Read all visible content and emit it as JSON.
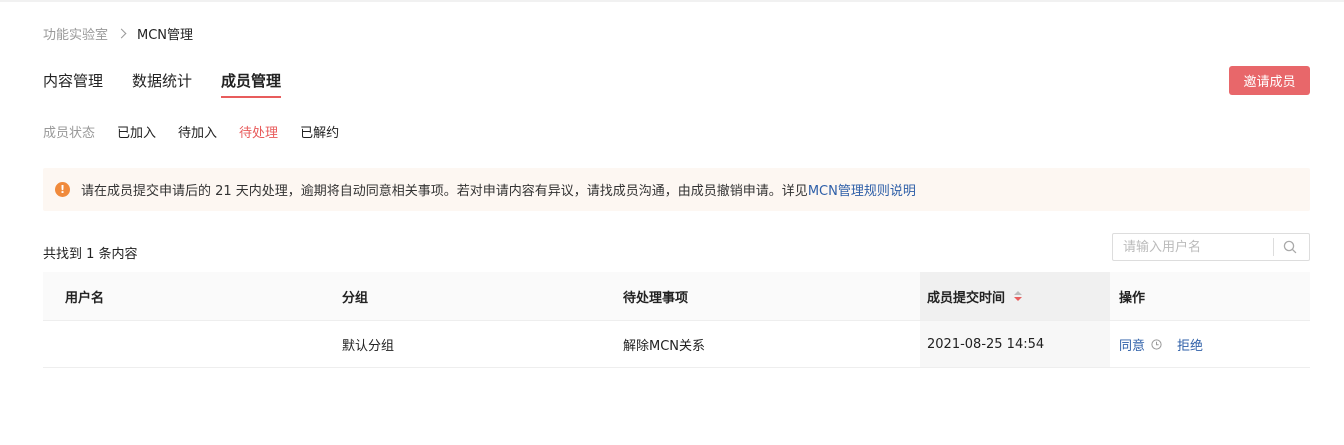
{
  "breadcrumb": {
    "parent": "功能实验室",
    "current": "MCN管理"
  },
  "tabs": [
    {
      "label": "内容管理",
      "active": false
    },
    {
      "label": "数据统计",
      "active": false
    },
    {
      "label": "成员管理",
      "active": true
    }
  ],
  "invite_button": "邀请成员",
  "status_filter": {
    "label": "成员状态",
    "options": [
      {
        "label": "已加入",
        "active": false
      },
      {
        "label": "待加入",
        "active": false
      },
      {
        "label": "待处理",
        "active": true
      },
      {
        "label": "已解约",
        "active": false
      }
    ]
  },
  "notice": {
    "icon": "!",
    "text": "请在成员提交申请后的 21 天内处理，逾期将自动同意相关事项。若对申请内容有异议，请找成员沟通，由成员撤销申请。详见",
    "link": "MCN管理规则说明"
  },
  "result_count": "共找到 1 条内容",
  "search": {
    "placeholder": "请输入用户名"
  },
  "table": {
    "headers": [
      "用户名",
      "分组",
      "待处理事项",
      "成员提交时间",
      "操作"
    ],
    "rows": [
      {
        "username": "",
        "group": "默认分组",
        "item": "解除MCN关系",
        "time": "2021-08-25 14:54",
        "agree": "同意",
        "reject": "拒绝"
      }
    ]
  },
  "colors": {
    "accent": "#e85c5c",
    "link": "#2e5fa8",
    "warning": "#f08a3c",
    "notice_bg": "#fdf7f2"
  }
}
